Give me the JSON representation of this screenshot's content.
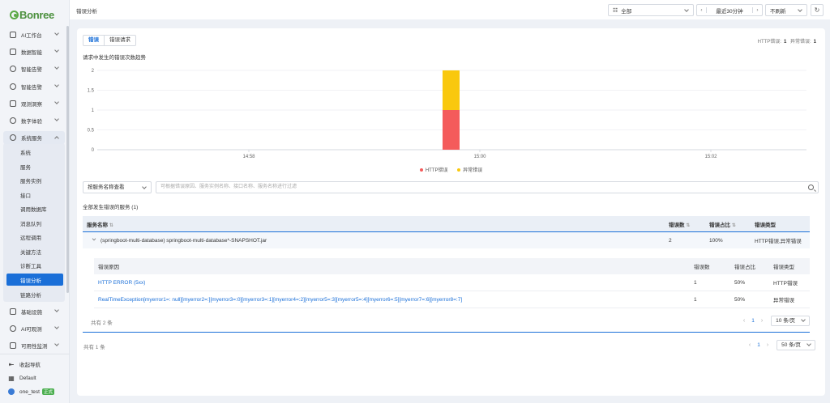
{
  "sidebar": {
    "logo": "Bonree",
    "items": [
      {
        "label": "AI工作台"
      },
      {
        "label": "数据智能"
      },
      {
        "label": "智能告警"
      },
      {
        "label": "智能告警"
      },
      {
        "label": "观测洞察"
      },
      {
        "label": "数字体验"
      },
      {
        "label": "系统服务"
      }
    ],
    "sub_items": [
      {
        "label": "系统"
      },
      {
        "label": "服务"
      },
      {
        "label": "服务实例"
      },
      {
        "label": "接口"
      },
      {
        "label": "调用数据库"
      },
      {
        "label": "消息队列"
      },
      {
        "label": "远程调用"
      },
      {
        "label": "关键方法"
      },
      {
        "label": "诊断工具"
      },
      {
        "label": "错误分析"
      },
      {
        "label": "链路分析"
      }
    ],
    "more_items": [
      {
        "label": "基础设施"
      },
      {
        "label": "AI可观测"
      },
      {
        "label": "可用性监测"
      }
    ],
    "collapse_label": "收起导航",
    "workspace": "Default",
    "user": "one_test",
    "user_badge": "正式"
  },
  "header": {
    "title": "错误分析",
    "env_select": "全部",
    "time_range": "最近30分钟",
    "refresh_select": "不刷新"
  },
  "tabs": [
    "错误",
    "错误请求"
  ],
  "counts": {
    "http_label": "HTTP错误:",
    "http_value": "1",
    "exc_label": "异常错误:",
    "exc_value": "1"
  },
  "chart_title": "请求中发生的错误次数趋势",
  "chart_data": {
    "type": "bar",
    "stacked": true,
    "categories": [
      "15:00"
    ],
    "x_ticks": [
      "14:58",
      "15:00",
      "15:02"
    ],
    "series": [
      {
        "name": "HTTP错误",
        "values": [
          1
        ],
        "color": "#f45b5b"
      },
      {
        "name": "异常错误",
        "values": [
          1
        ],
        "color": "#f9c80e"
      }
    ],
    "y_ticks": [
      "0",
      "0.5",
      "1",
      "1.5",
      "2"
    ],
    "ylim": [
      0,
      2
    ],
    "grid": true,
    "legend": "bottom"
  },
  "filter": {
    "group_label": "按服务名称查看",
    "search_placeholder": "可根据错误原因、服务实例名称、接口名称、服务名称进行过滤"
  },
  "service_section_title": "全部发生错误的服务 (1)",
  "service_table": {
    "columns": [
      "服务名称",
      "错误数",
      "错误占比",
      "错误类型"
    ],
    "rows": [
      {
        "name": "(springboot-multi-database) springboot-multi-database*-SNAPSHOT.jar",
        "count": "2",
        "ratio": "100%",
        "type": "HTTP错误,异常错误"
      }
    ]
  },
  "error_table": {
    "columns": [
      "错误原因",
      "错误数",
      "错误占比",
      "错误类型"
    ],
    "rows": [
      {
        "reason": "HTTP ERROR (5xx)",
        "count": "1",
        "ratio": "50%",
        "type": "HTTP错误"
      },
      {
        "reason": "RealTimeException[myerror1=: null][myerror2=:][myerror3=:0][myerror3=:1][myerror4=:2][myerror5=:3][myerror5=:4][myerror6=:5][myerror7=:6][myerror8=:7]",
        "count": "1",
        "ratio": "50%",
        "type": "异常错误"
      }
    ],
    "total": "共有 2 条",
    "page": "1",
    "page_size": "10 条/页"
  },
  "outer_pager": {
    "total": "共有 1 条",
    "page": "1",
    "page_size": "50 条/页"
  }
}
